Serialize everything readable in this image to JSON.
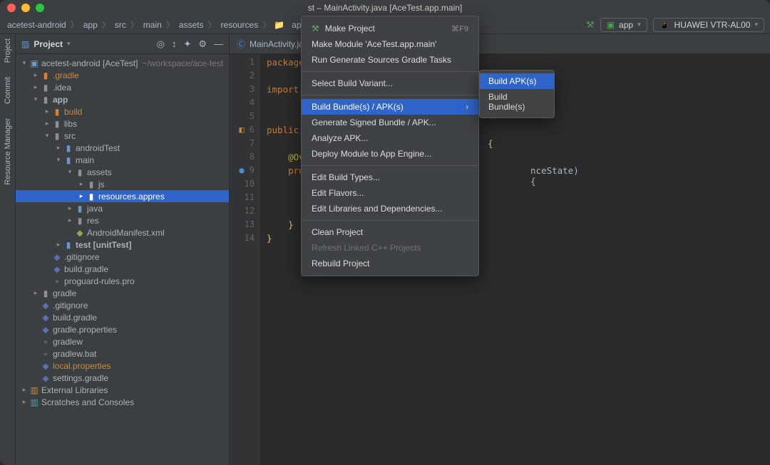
{
  "titlebar": {
    "suffix": "st – MainActivity.java [AceTest.app.main]"
  },
  "breadcrumb": [
    "acetest-android",
    "app",
    "src",
    "main",
    "assets",
    "resources",
    "appres"
  ],
  "breadcrumb_last_icon": "folder-icon",
  "toolbar": {
    "run_config_icon": "app-icon",
    "run_config_label": "app",
    "device_label": "HUAWEI VTR-AL00"
  },
  "gutter_left": [
    {
      "name": "project-tool",
      "label": "Project"
    },
    {
      "name": "commit-tool",
      "label": "Commit"
    },
    {
      "name": "resource-manager-tool",
      "label": "Resource Manager"
    }
  ],
  "project_panel": {
    "title": "Project",
    "actions": [
      "target-icon",
      "sort-icon",
      "filter-icon",
      "gear-icon",
      "hide-icon"
    ]
  },
  "tree": [
    {
      "d": 0,
      "a": "v",
      "i": "proj",
      "t": "acetest-android [AceTest]",
      "suffix": "~/workspace/ace-test"
    },
    {
      "d": 1,
      "a": ">",
      "i": "folder orange",
      "t": ".gradle",
      "cls": "accent"
    },
    {
      "d": 1,
      "a": ">",
      "i": "folder gray",
      "t": ".idea"
    },
    {
      "d": 1,
      "a": "v",
      "i": "folder gray",
      "t": "app",
      "bold": true
    },
    {
      "d": 2,
      "a": ">",
      "i": "folder orange",
      "t": "build",
      "cls": "accent"
    },
    {
      "d": 2,
      "a": ">",
      "i": "folder gray",
      "t": "libs"
    },
    {
      "d": 2,
      "a": "v",
      "i": "folder gray",
      "t": "src"
    },
    {
      "d": 3,
      "a": ">",
      "i": "folder blue",
      "t": "androidTest"
    },
    {
      "d": 3,
      "a": "v",
      "i": "folder blue",
      "t": "main"
    },
    {
      "d": 4,
      "a": "v",
      "i": "folder gray",
      "t": "assets"
    },
    {
      "d": 5,
      "a": ">",
      "i": "folder gray",
      "t": "js"
    },
    {
      "d": 5,
      "a": ">",
      "i": "folder blue",
      "t": "resources.appres",
      "sel": true
    },
    {
      "d": 4,
      "a": ">",
      "i": "folder blue",
      "t": "java"
    },
    {
      "d": 4,
      "a": ">",
      "i": "folder gray",
      "t": "res"
    },
    {
      "d": 4,
      "a": " ",
      "i": "xml",
      "t": "AndroidManifest.xml"
    },
    {
      "d": 3,
      "a": ">",
      "i": "folder blue",
      "t": "test [unitTest]",
      "bold": true
    },
    {
      "d": 2,
      "a": " ",
      "i": "git",
      "t": ".gitignore"
    },
    {
      "d": 2,
      "a": " ",
      "i": "gradle",
      "t": "build.gradle"
    },
    {
      "d": 2,
      "a": " ",
      "i": "file",
      "t": "proguard-rules.pro"
    },
    {
      "d": 1,
      "a": ">",
      "i": "folder gray",
      "t": "gradle"
    },
    {
      "d": 1,
      "a": " ",
      "i": "git",
      "t": ".gitignore"
    },
    {
      "d": 1,
      "a": " ",
      "i": "gradle",
      "t": "build.gradle"
    },
    {
      "d": 1,
      "a": " ",
      "i": "gradle",
      "t": "gradle.properties"
    },
    {
      "d": 1,
      "a": " ",
      "i": "file",
      "t": "gradlew"
    },
    {
      "d": 1,
      "a": " ",
      "i": "file",
      "t": "gradlew.bat"
    },
    {
      "d": 1,
      "a": " ",
      "i": "gradle",
      "t": "local.properties",
      "cls": "accent"
    },
    {
      "d": 1,
      "a": " ",
      "i": "gradle",
      "t": "settings.gradle"
    },
    {
      "d": 0,
      "a": ">",
      "i": "lib",
      "t": "External Libraries"
    },
    {
      "d": 0,
      "a": ">",
      "i": "scratch",
      "t": "Scratches and Consoles"
    }
  ],
  "editor": {
    "tab": {
      "file": "MainActivity.java"
    },
    "lines": [
      {
        "n": 1,
        "html": "<span class='kw'>package</span>"
      },
      {
        "n": 2,
        "html": ""
      },
      {
        "n": 3,
        "html": "<span class='kw'>import</span>"
      },
      {
        "n": 4,
        "html": ""
      },
      {
        "n": 5,
        "html": ""
      },
      {
        "n": 6,
        "html": "<span class='kw'>public</span>",
        "gut": "ov"
      },
      {
        "n": 7,
        "html": "",
        "tail": "<span class='brace'>{</span>",
        "tailpos": 310
      },
      {
        "n": 8,
        "html": "&nbsp;&nbsp;&nbsp;&nbsp;<span class='ann'>@Ov</span>"
      },
      {
        "n": 9,
        "html": "&nbsp;&nbsp;&nbsp;&nbsp;<span class='kw'>pro</span>",
        "gut": "impl",
        "tail": "<span class='txt'>nceState) {</span>",
        "tailpos": 370
      },
      {
        "n": 10,
        "html": ""
      },
      {
        "n": 11,
        "html": ""
      },
      {
        "n": 12,
        "html": ""
      },
      {
        "n": 13,
        "html": "&nbsp;&nbsp;&nbsp;&nbsp;<span class='brace'>}</span>"
      },
      {
        "n": 14,
        "html": "<span class='brace'>}</span>"
      }
    ]
  },
  "menu": {
    "items": [
      {
        "label": "Make Project",
        "icon": "hammer",
        "shortcut": "⌘F9"
      },
      {
        "label": "Make Module 'AceTest.app.main'"
      },
      {
        "label": "Run Generate Sources Gradle Tasks"
      },
      {
        "sep": true
      },
      {
        "label": "Select Build Variant..."
      },
      {
        "sep": true
      },
      {
        "label": "Build Bundle(s) / APK(s)",
        "sub": true,
        "hl": true
      },
      {
        "label": "Generate Signed Bundle / APK..."
      },
      {
        "label": "Analyze APK..."
      },
      {
        "label": "Deploy Module to App Engine..."
      },
      {
        "sep": true
      },
      {
        "label": "Edit Build Types..."
      },
      {
        "label": "Edit Flavors..."
      },
      {
        "label": "Edit Libraries and Dependencies..."
      },
      {
        "sep": true
      },
      {
        "label": "Clean Project"
      },
      {
        "label": "Refresh Linked C++ Projects",
        "dis": true
      },
      {
        "label": "Rebuild Project"
      }
    ],
    "submenu": [
      {
        "label": "Build APK(s)",
        "hl": true
      },
      {
        "label": "Build Bundle(s)"
      }
    ]
  }
}
